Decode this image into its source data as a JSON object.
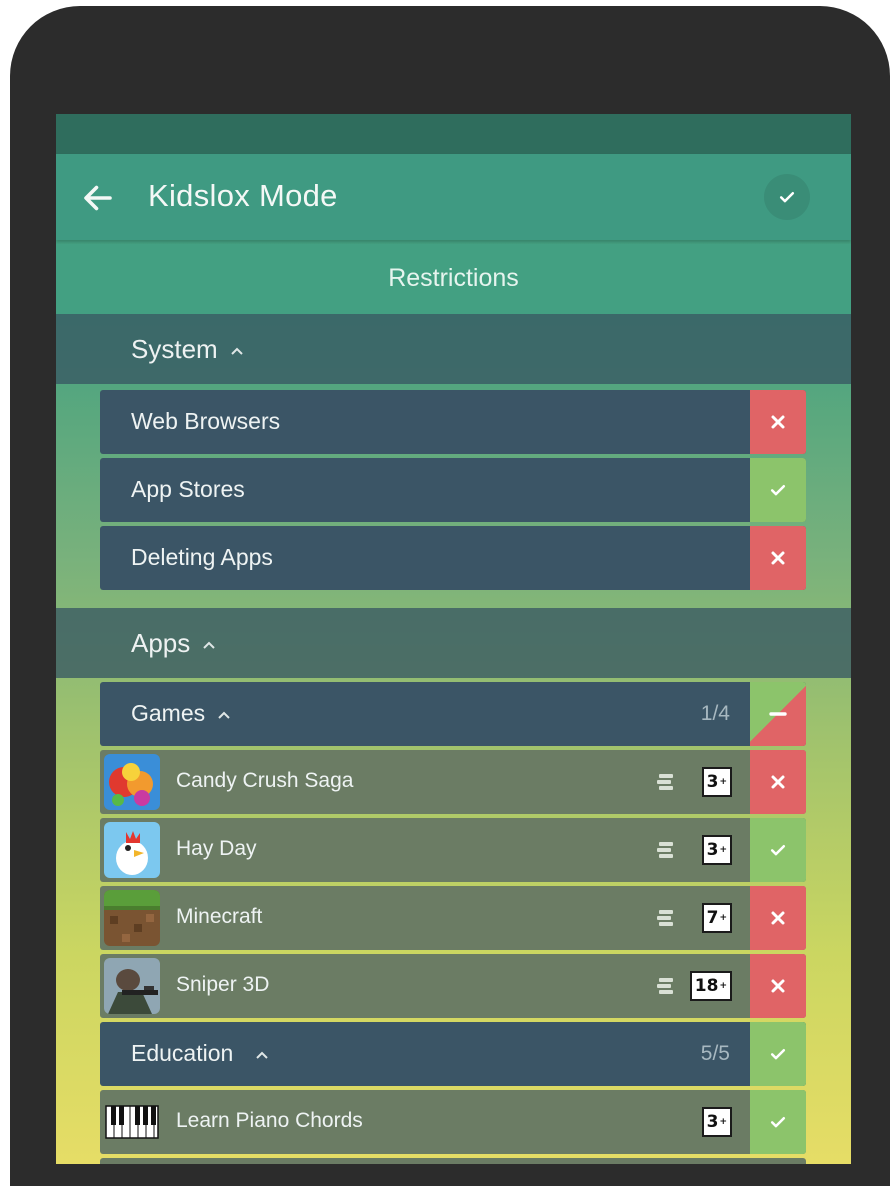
{
  "header": {
    "title": "Kidslox Mode",
    "subtitle": "Restrictions"
  },
  "system": {
    "label": "System",
    "items": [
      {
        "label": "Web Browsers",
        "status": "blocked"
      },
      {
        "label": "App Stores",
        "status": "allowed"
      },
      {
        "label": "Deleting Apps",
        "status": "blocked"
      }
    ]
  },
  "apps": {
    "label": "Apps",
    "categories": [
      {
        "label": "Games",
        "count": "1/4",
        "status": "partial",
        "items": [
          {
            "name": "Candy Crush Saga",
            "age": "3",
            "status": "blocked",
            "icon": "candy-crush-icon"
          },
          {
            "name": "Hay Day",
            "age": "3",
            "status": "allowed",
            "icon": "hay-day-icon"
          },
          {
            "name": "Minecraft",
            "age": "7",
            "status": "blocked",
            "icon": "minecraft-icon"
          },
          {
            "name": "Sniper 3D",
            "age": "18",
            "status": "blocked",
            "icon": "sniper-3d-icon"
          }
        ]
      },
      {
        "label": "Education",
        "count": "5/5",
        "status": "allowed",
        "items": [
          {
            "name": "Learn Piano Chords",
            "age": "3",
            "status": "allowed",
            "icon": "piano-icon"
          }
        ]
      }
    ]
  },
  "colors": {
    "primary": "#3f9a82",
    "row_dark": "#3b5566",
    "row_app": "#6b7c64",
    "blocked": "#e06466",
    "allowed": "#8cc46b"
  }
}
